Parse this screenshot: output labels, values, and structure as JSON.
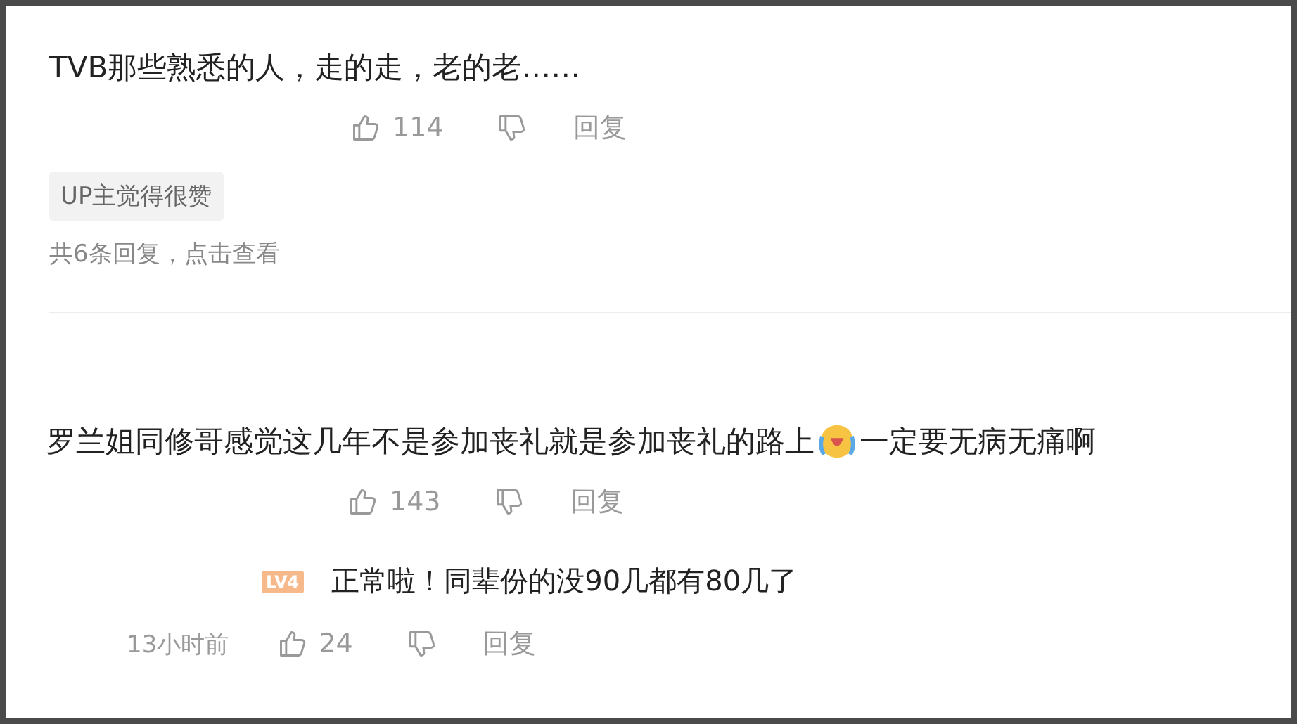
{
  "comments": [
    {
      "text": "TVB那些熟悉的人，走的走，老的老……",
      "likes": "114",
      "reply_label": "回复",
      "badge": "UP主觉得很赞",
      "replies_link": "共6条回复，点击查看"
    },
    {
      "text_before": "罗兰姐同修哥感觉这几年不是参加丧礼就是参加丧礼的路上",
      "text_after": "一定要无病无痛啊",
      "likes": "143",
      "reply_label": "回复",
      "reply": {
        "level": "LV4",
        "text": "正常啦！同辈份的没90几都有80几了",
        "time": "13小时前",
        "likes": "24",
        "reply_label": "回复"
      }
    }
  ]
}
